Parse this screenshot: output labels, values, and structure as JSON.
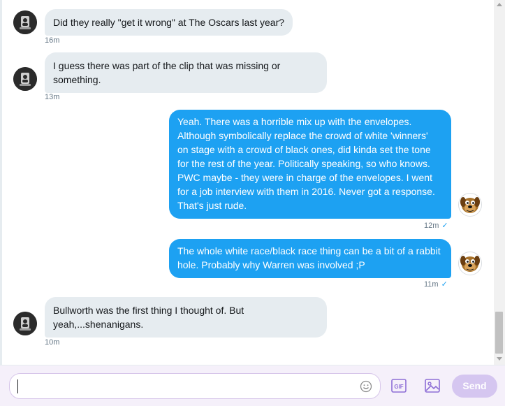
{
  "messages": [
    {
      "side": "received",
      "lines": [
        "Did they really \"get it wrong\" at The Oscars last year?"
      ],
      "time": "16m"
    },
    {
      "side": "received",
      "lines": [
        "I guess there was part of the clip that was missing or",
        "something."
      ],
      "time": "13m"
    },
    {
      "side": "sent",
      "lines": [
        "Yeah. There was a horrible mix up with the envelopes.",
        "Although symbolically replace the crowd of white 'winners'",
        "on stage with a crowd of black ones, did kinda set the tone",
        "for the rest of the year. Politically speaking, so who knows.",
        "PWC maybe - they were in charge of the envelopes. I went",
        "for a job interview with them in 2016. Never got a response.",
        "That's just rude."
      ],
      "time": "12m",
      "read": "✓"
    },
    {
      "side": "sent",
      "lines": [
        "The whole white race/black race thing can be a bit of a rabbit",
        "hole. Probably why Warren was involved ;P"
      ],
      "time": "11m",
      "read": "✓"
    },
    {
      "side": "received",
      "lines": [
        "Bullworth was the first thing I thought of. But",
        "yeah,...shenanigans."
      ],
      "time": "10m"
    }
  ],
  "composer": {
    "value": "",
    "placeholder": "",
    "emoji_icon": "smiley-icon",
    "gif_label": "GIF",
    "image_icon": "image-icon",
    "send_label": "Send"
  },
  "colors": {
    "sent_bubble": "#1da1f2",
    "received_bubble": "#e6ecf0",
    "accent": "#1da1f2",
    "send_button_disabled": "#d5c6f0",
    "composer_bg": "#f5f0fa"
  }
}
